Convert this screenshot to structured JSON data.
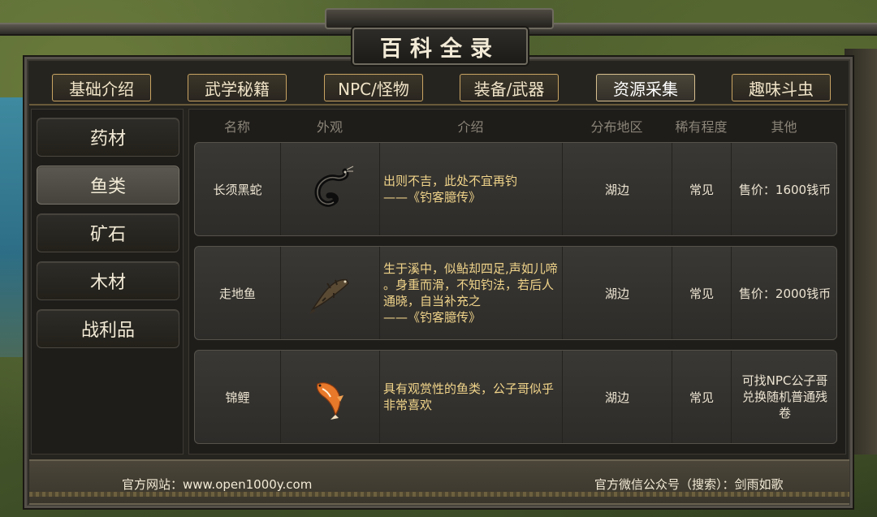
{
  "window": {
    "title": "百科全录"
  },
  "top_tabs": [
    {
      "label": "基础介绍",
      "active": false
    },
    {
      "label": "武学秘籍",
      "active": false
    },
    {
      "label": "NPC/怪物",
      "active": false
    },
    {
      "label": "装备/武器",
      "active": false
    },
    {
      "label": "资源采集",
      "active": true
    },
    {
      "label": "趣味斗虫",
      "active": false
    }
  ],
  "sidebar": {
    "items": [
      {
        "label": "药材",
        "active": false
      },
      {
        "label": "鱼类",
        "active": true
      },
      {
        "label": "矿石",
        "active": false
      },
      {
        "label": "木材",
        "active": false
      },
      {
        "label": "战利品",
        "active": false
      }
    ]
  },
  "table": {
    "headers": [
      "名称",
      "外观",
      "介绍",
      "分布地区",
      "稀有程度",
      "其他"
    ],
    "rows": [
      {
        "name": "长须黑蛇",
        "icon": "black-eel-icon",
        "desc": [
          "出则不吉，此处不宜再钓",
          "——《钓客臆传》"
        ],
        "region": "湖边",
        "rarity": "常见",
        "other": "售价：1600钱币"
      },
      {
        "name": "走地鱼",
        "icon": "walking-fish-icon",
        "desc": [
          "生于溪中，似鲇却四足,声如儿啼",
          "。身重而滑，不知钓法，若后人",
          "通晓，自当补充之",
          "——《钓客臆传》"
        ],
        "region": "湖边",
        "rarity": "常见",
        "other": "售价：2000钱币"
      },
      {
        "name": "锦鲤",
        "icon": "koi-icon",
        "desc": [
          "具有观赏性的鱼类，公子哥似乎",
          "非常喜欢"
        ],
        "region": "湖边",
        "rarity": "常见",
        "other": "可找NPC公子哥兑换随机普通残卷"
      }
    ]
  },
  "footer": {
    "website": "官方网站：www.open1000y.com",
    "wechat": "官方微信公众号（搜索）：剑雨如歌"
  },
  "colors": {
    "accent_gold": "#c9a463",
    "desc_text": "#f0d48a"
  }
}
